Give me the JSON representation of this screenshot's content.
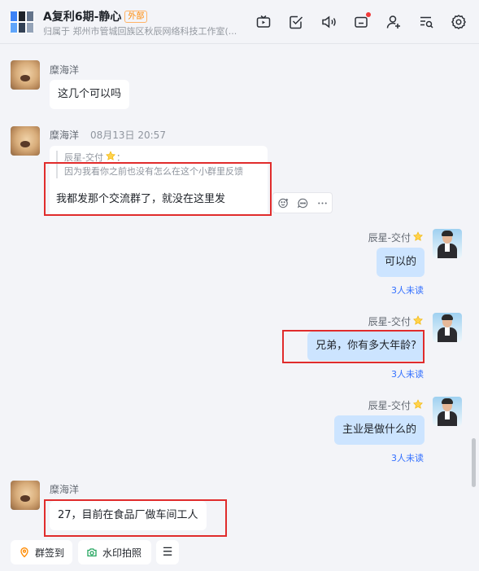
{
  "header": {
    "title": "A复利6期-静心",
    "external_tag": "外部",
    "subtitle": "归属于 郑州市管城回族区秋辰网络科技工作室(..."
  },
  "toolbar": {
    "items": [
      {
        "name": "tv-icon"
      },
      {
        "name": "checkbox-icon"
      },
      {
        "name": "speaker-icon"
      },
      {
        "name": "message-box-icon"
      },
      {
        "name": "add-user-icon"
      },
      {
        "name": "search-list-icon"
      },
      {
        "name": "gear-icon"
      }
    ]
  },
  "messages": [
    {
      "sender": "糜海洋",
      "text": "这几个可以吗"
    },
    {
      "sender": "糜海洋",
      "time": "08月13日 20:57",
      "quote_author": "辰星-交付",
      "quote_colon": "：",
      "quote_text": "因为我看你之前也没有怎么在这个小群里反馈",
      "text": "我都发那个交流群了，就没在这里发"
    },
    {
      "sender": "辰星-交付",
      "text": "可以的",
      "read": "3人未读"
    },
    {
      "sender": "辰星-交付",
      "text": "兄弟，你有多大年龄?",
      "read": "3人未读"
    },
    {
      "sender": "辰星-交付",
      "text": "主业是做什么的",
      "read": "3人未读"
    },
    {
      "sender": "糜海洋",
      "text": "27，目前在食品厂做车间工人"
    }
  ],
  "quick_actions": {
    "checkin": "群签到",
    "watermark": "水印拍照",
    "more": "☰"
  },
  "colors": {
    "accent": "#3370ff",
    "highlight": "#e02c2c",
    "external": "#ff8800",
    "own_bubble": "#cce4ff"
  }
}
